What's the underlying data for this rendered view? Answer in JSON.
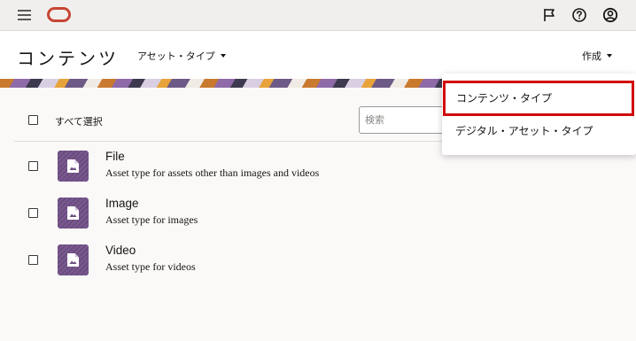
{
  "topbar": {
    "menu_icon": "hamburger-icon",
    "logo_icon": "oracle-logo",
    "right_icons": [
      "flag-icon",
      "help-icon",
      "user-icon"
    ]
  },
  "header": {
    "title": "コンテンツ",
    "type_select_label": "アセット・タイプ",
    "create_label": "作成"
  },
  "toolbar": {
    "select_all_label": "すべて選択",
    "search_placeholder": "検索"
  },
  "items": [
    {
      "name": "File",
      "description": "Asset type for assets other than images and videos"
    },
    {
      "name": "Image",
      "description": "Asset type for images"
    },
    {
      "name": "Video",
      "description": "Asset type for videos"
    }
  ],
  "create_menu": {
    "items": [
      {
        "label": "コンテンツ・タイプ",
        "highlighted": true
      },
      {
        "label": "デジタル・アセット・タイプ",
        "highlighted": false
      }
    ]
  },
  "colors": {
    "brand": "#c74634",
    "highlight_border": "#d10c0c",
    "thumb": "#7a5a8e"
  }
}
